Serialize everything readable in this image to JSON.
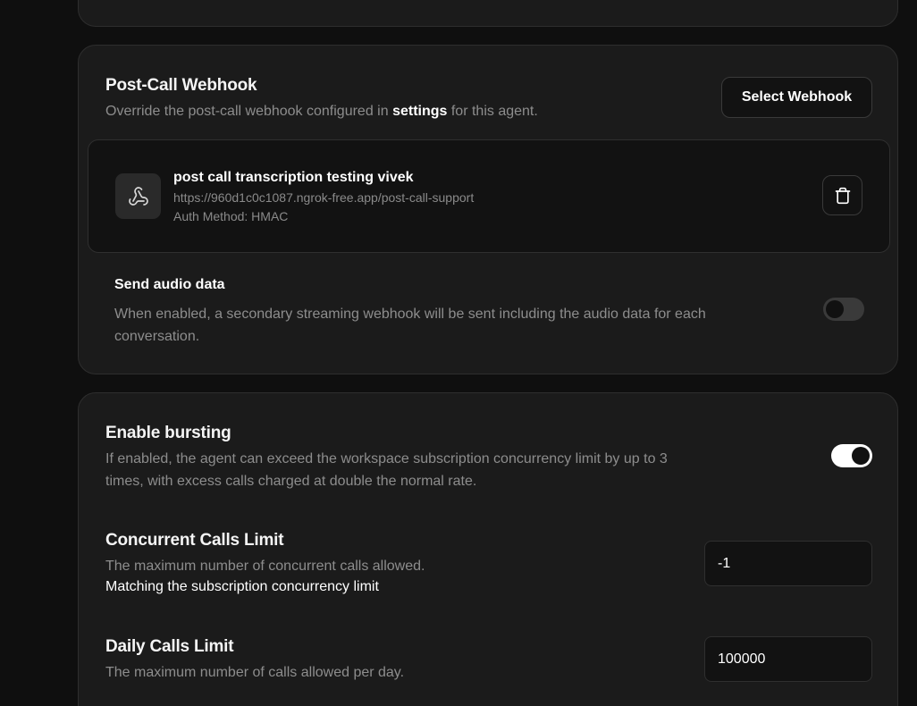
{
  "webhook_section": {
    "title": "Post-Call Webhook",
    "description_before": "Override the post-call webhook configured in ",
    "description_link": "settings",
    "description_after": " for this agent.",
    "select_button_label": "Select Webhook",
    "item": {
      "icon": "webhook-icon",
      "name": "post call transcription testing vivek",
      "url": "https://960d1c0c1087.ngrok-free.app/post-call-support",
      "auth_method": "Auth Method: HMAC",
      "delete_icon": "trash-icon"
    },
    "send_audio": {
      "title": "Send audio data",
      "description": "When enabled, a secondary streaming webhook will be sent including the audio data for each conversation.",
      "enabled": false
    }
  },
  "limits_section": {
    "bursting": {
      "title": "Enable bursting",
      "description": "If enabled, the agent can exceed the workspace subscription concurrency limit by up to 3 times, with excess calls charged at double the normal rate.",
      "enabled": true
    },
    "concurrent": {
      "title": "Concurrent Calls Limit",
      "description": "The maximum number of concurrent calls allowed.",
      "note": "Matching the subscription concurrency limit",
      "value": "-1"
    },
    "daily": {
      "title": "Daily Calls Limit",
      "description": "The maximum number of calls allowed per day.",
      "value": "100000"
    }
  },
  "colors": {
    "page_bg": "#0f0f0f",
    "card_bg": "#1b1b1b",
    "muted_text": "#8d8d8d",
    "toggle_on": "#ffffff",
    "toggle_off": "#3a3a3a"
  }
}
